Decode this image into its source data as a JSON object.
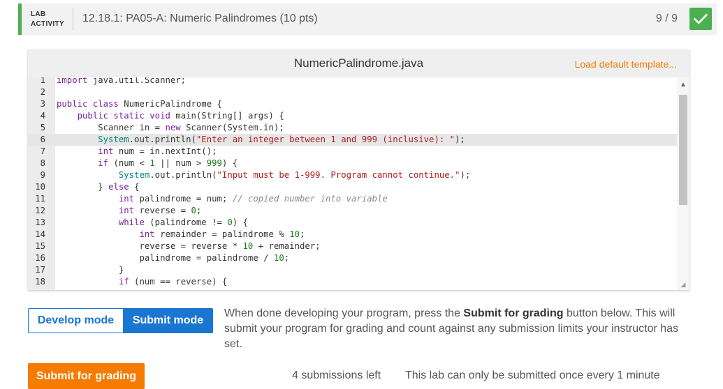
{
  "header": {
    "tag_line1": "LAB",
    "tag_line2": "ACTIVITY",
    "title": "12.18.1: PA05-A: Numeric Palindromes (10 pts)",
    "score": "9 / 9",
    "status_color": "#4caf50"
  },
  "editor": {
    "filename": "NumericPalindrome.java",
    "load_default": "Load default template...",
    "active_line": 6,
    "lines": [
      {
        "n": "1",
        "html": "<span class=\"kw\">import</span> java.util.Scanner;"
      },
      {
        "n": "2",
        "html": ""
      },
      {
        "n": "3",
        "html": "<span class=\"kw\">public class</span> NumericPalindrome {"
      },
      {
        "n": "4",
        "html": "    <span class=\"kw\">public static void</span> main(String[] args) {"
      },
      {
        "n": "5",
        "html": "        Scanner in = <span class=\"kw\">new</span> Scanner(System.in);"
      },
      {
        "n": "6",
        "html": "        <span class=\"cls\">System</span>.out.println(<span class=\"str\">\"Enter an integer between 1 and 999 (inclusive): \"</span>);"
      },
      {
        "n": "7",
        "html": "        <span class=\"kw\">int</span> num = in.nextInt();"
      },
      {
        "n": "8",
        "html": "        <span class=\"kw\">if</span> (num &lt; <span class=\"num\">1</span> || num &gt; <span class=\"num\">999</span>) {"
      },
      {
        "n": "9",
        "html": "            <span class=\"cls\">System</span>.out.println(<span class=\"str\">\"Input must be 1-999. Program cannot continue.\"</span>);"
      },
      {
        "n": "10",
        "html": "        } <span class=\"kw\">else</span> {"
      },
      {
        "n": "11",
        "html": "            <span class=\"kw\">int</span> palindrome = num; <span class=\"cm\">// copied number into variable</span>"
      },
      {
        "n": "12",
        "html": "            <span class=\"kw\">int</span> reverse = <span class=\"num\">0</span>;"
      },
      {
        "n": "13",
        "html": "            <span class=\"kw\">while</span> (palindrome != <span class=\"num\">0</span>) {"
      },
      {
        "n": "14",
        "html": "                <span class=\"kw\">int</span> remainder = palindrome % <span class=\"num\">10</span>;"
      },
      {
        "n": "15",
        "html": "                reverse = reverse * <span class=\"num\">10</span> + remainder;"
      },
      {
        "n": "16",
        "html": "                palindrome = palindrome / <span class=\"num\">10</span>;"
      },
      {
        "n": "17",
        "html": "            }"
      },
      {
        "n": "18",
        "html": "            <span class=\"kw\">if</span> (num == reverse) {"
      }
    ]
  },
  "modes": {
    "develop": "Develop mode",
    "submit": "Submit mode"
  },
  "instructions": {
    "before": "When done developing your program, press the ",
    "bold": "Submit for grading",
    "after": " button below. This will submit your program for grading and count against any submission limits your instructor has set."
  },
  "footer": {
    "submit_button": "Submit for grading",
    "submissions_left": "4 submissions left",
    "rate_limit": "This lab can only be submitted once every 1 minute"
  }
}
